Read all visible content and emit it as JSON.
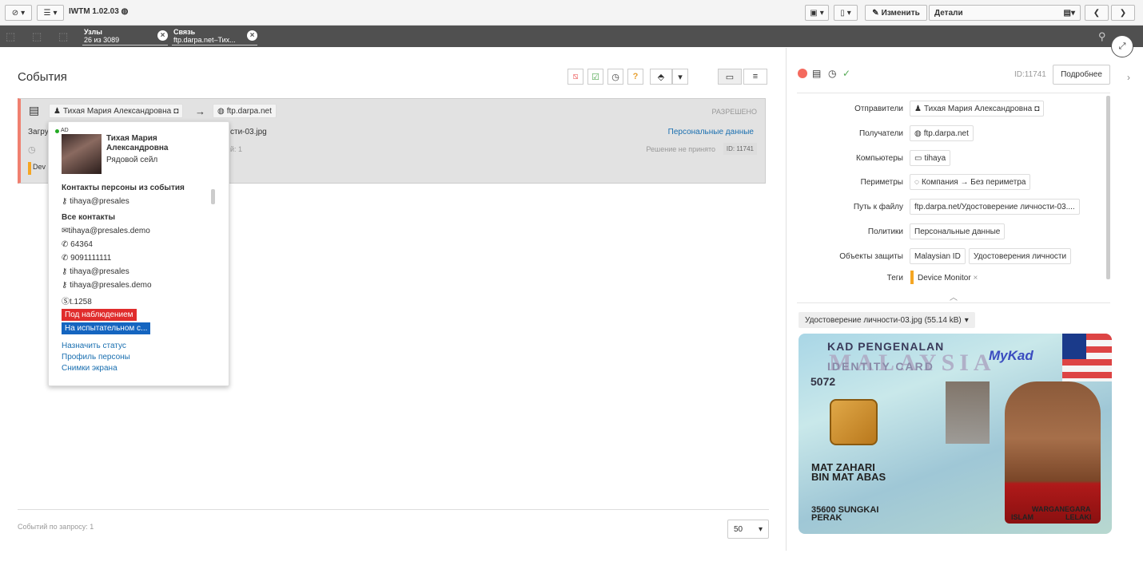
{
  "app": {
    "title": "IWTM 1.02.03"
  },
  "toolbar": {
    "edit": "Изменить",
    "details": "Детали"
  },
  "filters": [
    {
      "title": "Узлы",
      "sub": "26 из 3089"
    },
    {
      "title": "Связь",
      "sub": "ftp.darpa.net–Тих..."
    }
  ],
  "events": {
    "title": "События",
    "count_label": "Событий по запросу: 1",
    "page_size": "50"
  },
  "event": {
    "sender": "Тихая Мария Александровна",
    "receiver": "ftp.darpa.net",
    "status": "РАЗРЕШЕНО",
    "file_partial": "сти-03.jpg",
    "row2_start": "Загру",
    "row3_partial": "й: 1",
    "policy": "Персональные данные",
    "decision": "Решение не принято",
    "id": "ID: 11741",
    "tag_partial": "Dev"
  },
  "popup": {
    "ad": "AD",
    "name": "Тихая Мария Александровна",
    "role": "Рядовой сейл",
    "event_contacts_title": "Контакты персоны из события",
    "event_contact": "tihaya@presales",
    "all_contacts_title": "Все контакты",
    "contacts": [
      "tihaya@presales.demo",
      "64364",
      "9091111111",
      "tihaya@presales",
      "tihaya@presales.demo",
      "t.1258"
    ],
    "status1": "Под наблюдением",
    "status2": "На испытательном с...",
    "links": [
      "Назначить статус",
      "Профиль персоны",
      "Снимки экрана"
    ]
  },
  "details": {
    "id": "ID:11741",
    "more": "Подробнее",
    "fields": [
      {
        "label": "Отправители",
        "values": [
          "Тихая Мария Александровна"
        ]
      },
      {
        "label": "Получатели",
        "values": [
          "ftp.darpa.net"
        ]
      },
      {
        "label": "Компьютеры",
        "values": [
          "tihaya"
        ]
      },
      {
        "label": "Периметры",
        "values": [
          "Компания → Без периметра"
        ]
      },
      {
        "label": "Путь к файлу",
        "values": [
          "ftp.darpa.net/Удостоверение личности-03...."
        ]
      },
      {
        "label": "Политики",
        "values": [
          "Персональные данные"
        ]
      },
      {
        "label": "Объекты защиты",
        "values": [
          "Malaysian ID",
          "Удостоверения личности"
        ]
      },
      {
        "label": "Теги",
        "values": [
          "Device Monitor"
        ]
      }
    ],
    "attachment": "Удостоверение личности-03.jpg (55.14 kB)"
  },
  "idcard": {
    "line1": "KAD PENGENALAN",
    "line2": "MALAYSIA",
    "line3": "IDENTITY CARD",
    "mykad": "MyKad",
    "number": "5072",
    "name1": "MAT ZAHARI",
    "name2": "BIN MAT ABAS",
    "addr1": "35600 SUNGKAI",
    "addr2": "PERAK",
    "cit": "WARGANEGARA",
    "rel": "ISLAM",
    "sex": "LELAKI"
  },
  "colors": {
    "accent": "#1a6fb0",
    "danger": "#e02c2c",
    "info": "#1565c0",
    "status_dot": "#f46a5e"
  }
}
